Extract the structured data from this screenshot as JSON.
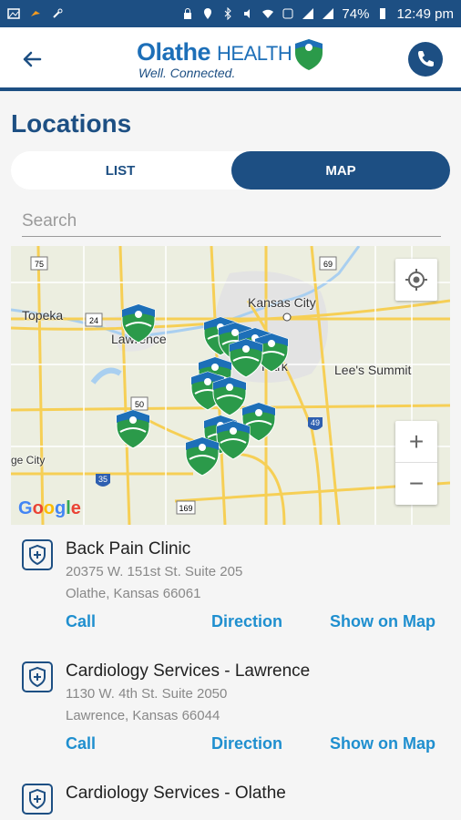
{
  "status_bar": {
    "battery": "74%",
    "time": "12:49 pm"
  },
  "header": {
    "brand_bold": "Olathe",
    "brand_light": "HEALTH",
    "tagline": "Well. Connected."
  },
  "page": {
    "title": "Locations",
    "tabs": [
      {
        "label": "LIST",
        "selected": false
      },
      {
        "label": "MAP",
        "selected": true
      }
    ],
    "search_placeholder": "Search"
  },
  "map": {
    "labels": [
      "Topeka",
      "Lawrence",
      "Kansas City",
      "Park",
      "Lee's Summit",
      "ge City",
      "Google"
    ],
    "route_shields": [
      "75",
      "24",
      "69",
      "50",
      "35",
      "169",
      "49"
    ],
    "marker_count": 14
  },
  "locations": [
    {
      "name": "Back Pain Clinic",
      "address_line1": "20375 W. 151st St. Suite 205",
      "address_line2": "Olathe, Kansas 66061",
      "actions": {
        "call": "Call",
        "direction": "Direction",
        "show_on_map": "Show on Map"
      }
    },
    {
      "name": "Cardiology Services - Lawrence",
      "address_line1": "1130 W. 4th St. Suite 2050",
      "address_line2": "Lawrence, Kansas 66044",
      "actions": {
        "call": "Call",
        "direction": "Direction",
        "show_on_map": "Show on Map"
      }
    },
    {
      "name": "Cardiology Services - Olathe",
      "address_line1": "",
      "address_line2": "",
      "actions": {
        "call": "",
        "direction": "",
        "show_on_map": ""
      }
    }
  ],
  "colors": {
    "primary": "#1d4f83",
    "accent": "#1f8fcf",
    "status_bar": "#1d4f83"
  }
}
